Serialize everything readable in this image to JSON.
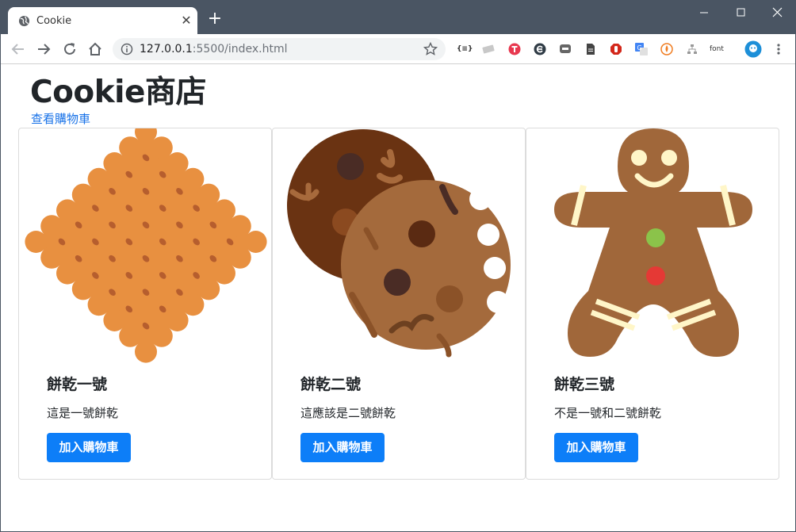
{
  "browser": {
    "tab_title": "Cookie",
    "tab_close": "✕",
    "new_tab": "+",
    "url_host": "127.0.0.1",
    "url_rest": ":5500/index.html",
    "ext_font_label": "font",
    "ext_json_label": "{≡}"
  },
  "page": {
    "brand": "Cookie商店",
    "cart_link": "查看購物車"
  },
  "products": [
    {
      "title": "餅乾一號",
      "desc": "這是一號餅乾",
      "button": "加入購物車",
      "icon": "cracker-icon"
    },
    {
      "title": "餅乾二號",
      "desc": "這應該是二號餅乾",
      "button": "加入購物車",
      "icon": "chocolate-cookie-icon"
    },
    {
      "title": "餅乾三號",
      "desc": "不是一號和二號餅乾",
      "button": "加入購物車",
      "icon": "gingerbread-man-icon"
    }
  ],
  "colors": {
    "titlebar": "#4a5563",
    "button": "#0d7ef8",
    "link": "#1a73e8",
    "cracker": "#e89040",
    "cookie_dark": "#6a3312",
    "cookie_light": "#a46a3c",
    "gingerbread": "#a0673a"
  }
}
